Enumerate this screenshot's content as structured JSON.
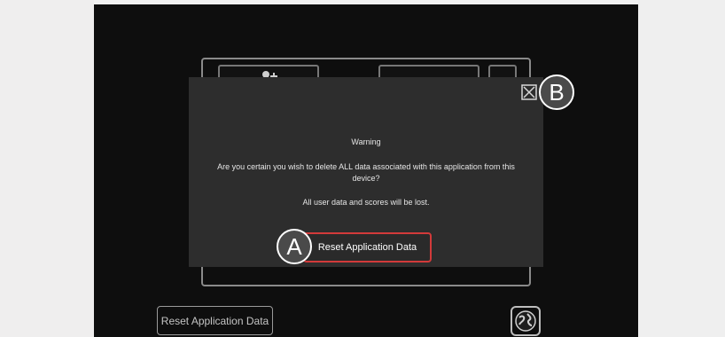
{
  "dialog": {
    "title": "Warning",
    "message": "Are you certain you wish to delete ALL data associated with this application from this device?",
    "note": "All user data and scores will be lost.",
    "reset_button_label": "Reset Application Data"
  },
  "background": {
    "reset_button_label": "Reset Application Data"
  },
  "callouts": {
    "a": "A",
    "b": "B"
  },
  "icons": {
    "close": "close-x-icon",
    "add_user": "add-user-icon",
    "globe": "globe-icon"
  },
  "colors": {
    "reset_border": "#d23a3a",
    "dialog_bg": "#2d2d2d",
    "screen_bg": "#0e0e0e"
  }
}
